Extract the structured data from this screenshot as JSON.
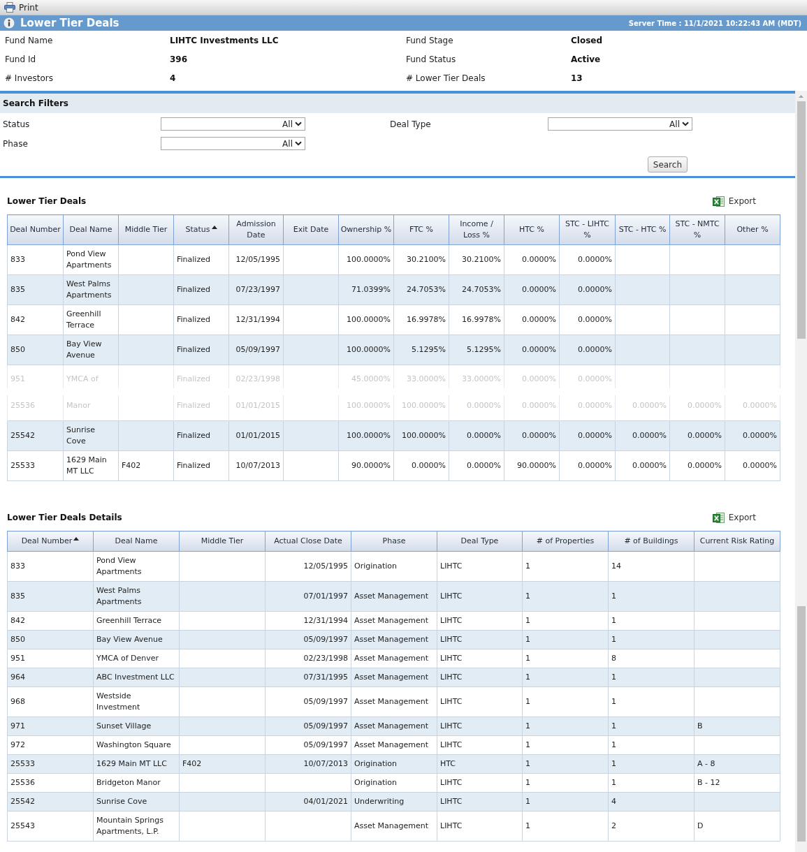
{
  "toolbar": {
    "print_label": "Print"
  },
  "header": {
    "title": "Lower Tier Deals",
    "server_time": "Server Time : 11/1/2021 10:22:43 AM (MDT)"
  },
  "fund_info": [
    {
      "label": "Fund Name",
      "value": "LIHTC Investments LLC"
    },
    {
      "label": "Fund Stage",
      "value": "Closed"
    },
    {
      "label": "Fund Id",
      "value": "396"
    },
    {
      "label": "Fund Status",
      "value": "Active"
    },
    {
      "label": "# Investors",
      "value": "4"
    },
    {
      "label": "# Lower Tier Deals",
      "value": "13"
    }
  ],
  "search_filters": {
    "title": "Search Filters",
    "filters": [
      {
        "label": "Status",
        "value": "All"
      },
      {
        "label": "Deal Type",
        "value": "All"
      },
      {
        "label": "Phase",
        "value": "All"
      }
    ],
    "search_button": "Search"
  },
  "deals_table": {
    "title": "Lower Tier Deals",
    "export_label": "Export",
    "columns": [
      {
        "label": "Deal Number",
        "kind": "text",
        "sorted": false
      },
      {
        "label": "Deal Name",
        "kind": "text",
        "sorted": false
      },
      {
        "label": "Middle Tier",
        "kind": "text",
        "sorted": false
      },
      {
        "label": "Status",
        "kind": "text",
        "sorted": true
      },
      {
        "label": "Admission Date",
        "kind": "date",
        "sorted": false
      },
      {
        "label": "Exit Date",
        "kind": "date",
        "sorted": false
      },
      {
        "label": "Ownership %",
        "kind": "percent",
        "sorted": false
      },
      {
        "label": "FTC %",
        "kind": "percent",
        "sorted": false
      },
      {
        "label": "Income / Loss %",
        "kind": "percent",
        "sorted": false
      },
      {
        "label": "HTC %",
        "kind": "percent",
        "sorted": false
      },
      {
        "label": "STC - LIHTC %",
        "kind": "percent",
        "sorted": false
      },
      {
        "label": "STC - HTC %",
        "kind": "percent",
        "sorted": false
      },
      {
        "label": "STC - NMTC %",
        "kind": "percent",
        "sorted": false
      },
      {
        "label": "Other %",
        "kind": "percent",
        "sorted": false
      }
    ],
    "rows": [
      {
        "cells": [
          "833",
          "Pond View Apartments",
          null,
          "Finalized",
          "12/05/1995",
          null,
          "100.0000%",
          "30.2100%",
          "30.2100%",
          "0.0000%",
          "0.0000%",
          null,
          null,
          null
        ],
        "shaded": false,
        "faded": false
      },
      {
        "cells": [
          "835",
          "West Palms Apartments",
          null,
          "Finalized",
          "07/23/1997",
          null,
          "71.0399%",
          "24.7053%",
          "24.7053%",
          "0.0000%",
          "0.0000%",
          null,
          null,
          null
        ],
        "shaded": true,
        "faded": false
      },
      {
        "cells": [
          "842",
          "Greenhill Terrace",
          null,
          "Finalized",
          "12/31/1994",
          null,
          "100.0000%",
          "16.9978%",
          "16.9978%",
          "0.0000%",
          "0.0000%",
          null,
          null,
          null
        ],
        "shaded": false,
        "faded": false
      },
      {
        "cells": [
          "850",
          "Bay View Avenue",
          null,
          "Finalized",
          "05/09/1997",
          null,
          "100.0000%",
          "5.1295%",
          "5.1295%",
          "0.0000%",
          "0.0000%",
          null,
          null,
          null
        ],
        "shaded": true,
        "faded": false
      },
      {
        "cells": [
          "951",
          "YMCA of",
          null,
          "Finalized",
          "02/23/1998",
          null,
          "45.0000%",
          "33.0000%",
          "33.0000%",
          "0.0000%",
          "0.0000%",
          null,
          null,
          null
        ],
        "shaded": false,
        "faded": true
      },
      {
        "cells": [
          "25536",
          "Manor",
          null,
          "Finalized",
          "01/01/2015",
          null,
          "100.0000%",
          "100.0000%",
          "0.0000%",
          "0.0000%",
          "0.0000%",
          "0.0000%",
          "0.0000%",
          "0.0000%"
        ],
        "shaded": false,
        "faded": true
      },
      {
        "cells": [
          "25542",
          "Sunrise Cove",
          null,
          "Finalized",
          "01/01/2015",
          null,
          "100.0000%",
          "100.0000%",
          "0.0000%",
          "0.0000%",
          "0.0000%",
          "0.0000%",
          "0.0000%",
          "0.0000%"
        ],
        "shaded": true,
        "faded": false
      },
      {
        "cells": [
          "25533",
          "1629 Main MT LLC",
          "F402",
          "Finalized",
          "10/07/2013",
          null,
          "90.0000%",
          "0.0000%",
          "0.0000%",
          "90.0000%",
          "0.0000%",
          "0.0000%",
          "0.0000%",
          "0.0000%"
        ],
        "shaded": false,
        "faded": false
      }
    ]
  },
  "details_table": {
    "title": "Lower Tier Deals Details",
    "export_label": "Export",
    "columns": [
      {
        "label": "Deal Number",
        "kind": "text",
        "sorted": true
      },
      {
        "label": "Deal Name",
        "kind": "text",
        "sorted": false
      },
      {
        "label": "Middle Tier",
        "kind": "text",
        "sorted": false
      },
      {
        "label": "Actual Close Date",
        "kind": "date",
        "sorted": false
      },
      {
        "label": "Phase",
        "kind": "text",
        "sorted": false
      },
      {
        "label": "Deal Type",
        "kind": "text",
        "sorted": false
      },
      {
        "label": "# of Properties",
        "kind": "text",
        "sorted": false
      },
      {
        "label": "# of Buildings",
        "kind": "text",
        "sorted": false
      },
      {
        "label": "Current Risk Rating",
        "kind": "text",
        "sorted": false
      }
    ],
    "rows": [
      {
        "cells": [
          "833",
          "Pond View Apartments",
          null,
          "12/05/1995",
          "Origination",
          "LIHTC",
          "1",
          "14",
          null
        ],
        "shaded": false
      },
      {
        "cells": [
          "835",
          "West Palms Apartments",
          null,
          "07/01/1997",
          "Asset Management",
          "LIHTC",
          "1",
          "1",
          null
        ],
        "shaded": true
      },
      {
        "cells": [
          "842",
          "Greenhill Terrace",
          null,
          "12/31/1994",
          "Asset Management",
          "LIHTC",
          "1",
          "1",
          null
        ],
        "shaded": false
      },
      {
        "cells": [
          "850",
          "Bay View Avenue",
          null,
          "05/09/1997",
          "Asset Management",
          "LIHTC",
          "1",
          "1",
          null
        ],
        "shaded": true
      },
      {
        "cells": [
          "951",
          "YMCA of Denver",
          null,
          "02/23/1998",
          "Asset Management",
          "LIHTC",
          "1",
          "8",
          null
        ],
        "shaded": false
      },
      {
        "cells": [
          "964",
          "ABC Investment LLC",
          null,
          "07/31/1995",
          "Asset Management",
          "LIHTC",
          "1",
          "1",
          null
        ],
        "shaded": true
      },
      {
        "cells": [
          "968",
          "Westside Investment",
          null,
          "05/09/1997",
          "Asset Management",
          "LIHTC",
          "1",
          "1",
          null
        ],
        "shaded": false
      },
      {
        "cells": [
          "971",
          "Sunset Village",
          null,
          "05/09/1997",
          "Asset Management",
          "LIHTC",
          "1",
          "1",
          "B"
        ],
        "shaded": true
      },
      {
        "cells": [
          "972",
          "Washington Square",
          null,
          "05/09/1997",
          "Asset Management",
          "LIHTC",
          "1",
          "1",
          null
        ],
        "shaded": false
      },
      {
        "cells": [
          "25533",
          "1629 Main MT LLC",
          "F402",
          "10/07/2013",
          "Origination",
          "HTC",
          "1",
          "1",
          "A - 8"
        ],
        "shaded": true
      },
      {
        "cells": [
          "25536",
          "Bridgeton Manor",
          null,
          null,
          "Origination",
          "LIHTC",
          "1",
          "1",
          "B - 12"
        ],
        "shaded": false
      },
      {
        "cells": [
          "25542",
          "Sunrise Cove",
          null,
          "04/01/2021",
          "Underwriting",
          "LIHTC",
          "1",
          "4",
          null
        ],
        "shaded": true
      },
      {
        "cells": [
          "25543",
          "Mountain Springs Apartments, L.P.",
          null,
          null,
          "Asset Management",
          "LIHTC",
          "1",
          "2",
          "D"
        ],
        "shaded": false
      }
    ]
  }
}
